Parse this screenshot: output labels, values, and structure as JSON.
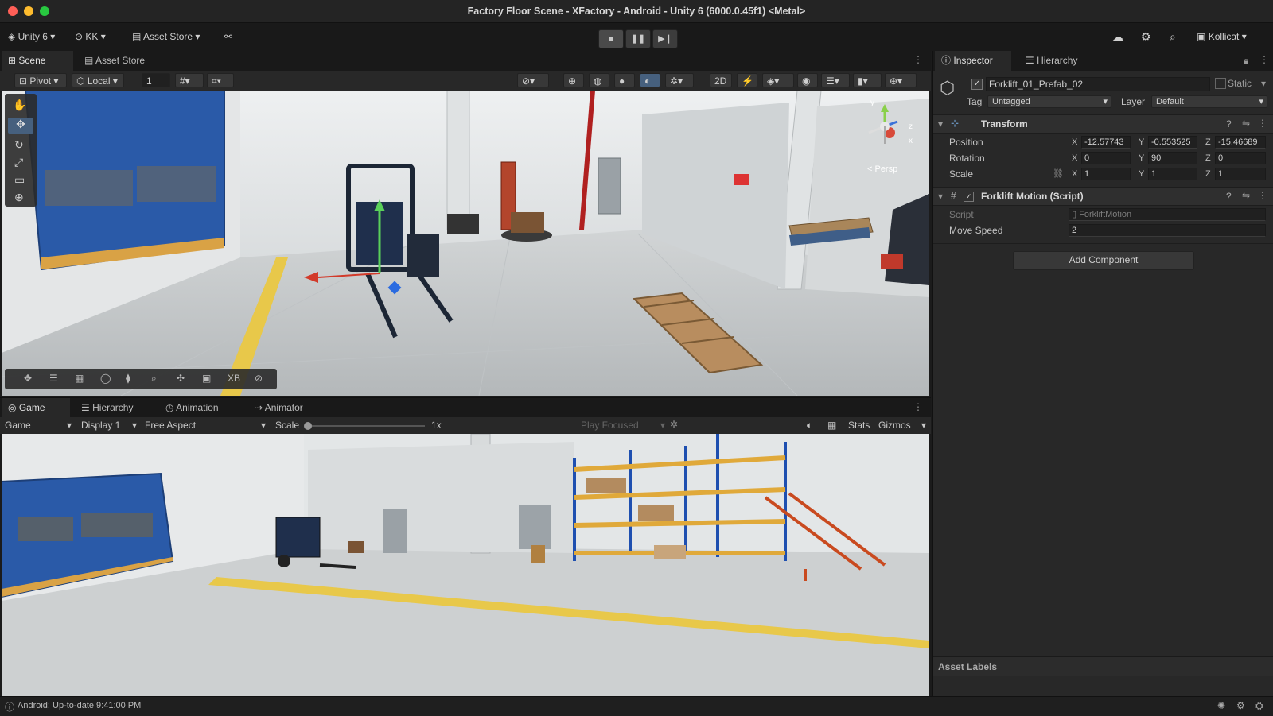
{
  "window": {
    "title": "Factory Floor Scene - XFactory - Android - Unity 6 (6000.0.45f1) <Metal>"
  },
  "toolbar": {
    "account_label": "Unity 6",
    "account_short": "KK",
    "asset_store": "Asset Store",
    "account_menu": "Kollicat",
    "play_icon": "stop-square-icon",
    "pause_icon": "pause-icon",
    "step_icon": "step-icon"
  },
  "scene_tabs": [
    {
      "label": "Scene"
    },
    {
      "label": "Asset Store"
    }
  ],
  "scene_toolbar": {
    "pivot": "Pivot",
    "local": "Local",
    "grid_value": "1",
    "mode_2d": "2D"
  },
  "scene_overlay": {
    "persp_label": "< Persp",
    "gizmo_y": "y",
    "gizmo_x": "x",
    "gizmo_z": "z",
    "xb_label": "XB"
  },
  "game_tabs": [
    {
      "label": "Game"
    },
    {
      "label": "Hierarchy"
    },
    {
      "label": "Animation"
    },
    {
      "label": "Animator"
    }
  ],
  "game_toolbar": {
    "mode": "Game",
    "display": "Display 1",
    "aspect": "Free Aspect",
    "scale_label": "Scale",
    "scale_value": "1x",
    "play_focused": "Play Focused",
    "stats": "Stats",
    "gizmos": "Gizmos"
  },
  "inspector_tabs": [
    {
      "label": "Inspector"
    },
    {
      "label": "Hierarchy"
    }
  ],
  "inspector": {
    "object_name": "Forklift_01_Prefab_02",
    "static_label": "Static",
    "tag_label": "Tag",
    "tag_value": "Untagged",
    "layer_label": "Layer",
    "layer_value": "Default",
    "transform": {
      "title": "Transform",
      "position_label": "Position",
      "rotation_label": "Rotation",
      "scale_label": "Scale",
      "position": {
        "x": "-12.57743",
        "y": "-0.553525",
        "z": "-15.46689"
      },
      "rotation": {
        "x": "0",
        "y": "90",
        "z": "0"
      },
      "scale": {
        "x": "1",
        "y": "1",
        "z": "1"
      }
    },
    "script_component": {
      "title": "Forklift Motion (Script)",
      "script_label": "Script",
      "script_value": "ForkliftMotion",
      "move_speed_label": "Move Speed",
      "move_speed_value": "2"
    },
    "add_component": "Add Component",
    "asset_labels": "Asset Labels"
  },
  "statusbar": {
    "message": "Android: Up-to-date 9:41:00 PM"
  },
  "colors": {
    "accent_blue": "#2a5aa8",
    "floor": "#cfd2d3",
    "yellow_line": "#e8c84a"
  }
}
